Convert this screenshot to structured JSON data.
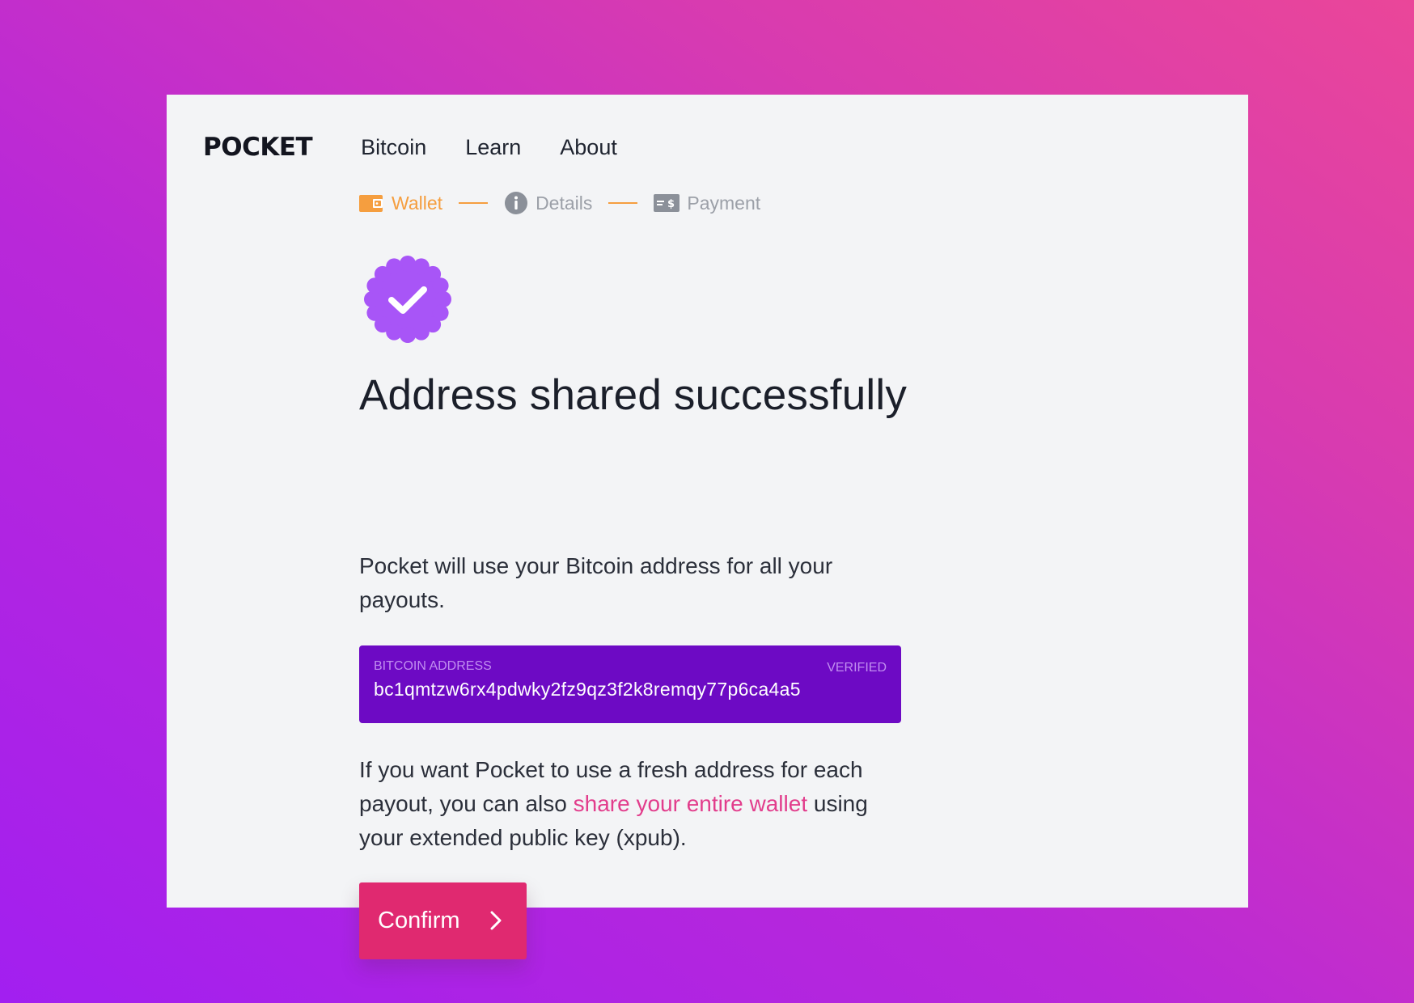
{
  "brand": {
    "logo": "POCKET"
  },
  "nav": {
    "links": [
      "Bitcoin",
      "Learn",
      "About"
    ]
  },
  "steps": [
    {
      "label": "Wallet",
      "icon": "wallet-icon",
      "state": "active"
    },
    {
      "label": "Details",
      "icon": "info-icon",
      "state": "inactive"
    },
    {
      "label": "Payment",
      "icon": "payment-icon",
      "state": "inactive"
    }
  ],
  "main": {
    "badge_icon": "verified-badge-icon",
    "title": "Address shared successfully",
    "intro": "Pocket will use your Bitcoin address for all your payouts.",
    "address": {
      "label": "BITCOIN ADDRESS",
      "status": "VERIFIED",
      "value": "bc1qmtzw6rx4pdwky2fz9qz3f2k8remqy77p6ca4a5"
    },
    "fresh_text_before": "If you want Pocket to use a fresh address for each payout, you can also ",
    "fresh_link": "share your entire wallet",
    "fresh_text_after": " using your extended public key (xpub).",
    "confirm_label": "Confirm"
  },
  "colors": {
    "accent": "#e02970",
    "step_active": "#f59e3f",
    "step_inactive": "#9ca0a8",
    "address_bg": "#6d0ac4",
    "badge": "#a855f7",
    "link": "#e23d8c"
  }
}
